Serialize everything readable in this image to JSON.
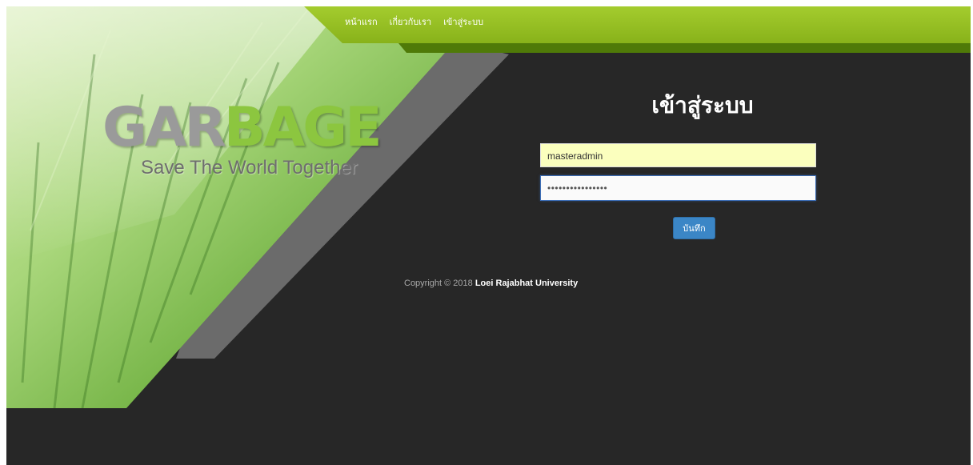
{
  "nav": {
    "items": [
      {
        "label": "หน้าแรก"
      },
      {
        "label": "เกี่ยวกับเรา"
      },
      {
        "label": "เข้าสู่ระบบ"
      }
    ]
  },
  "brand": {
    "logo_part1": "GAR",
    "logo_part2": "BAGE",
    "tagline": "Save The World Together"
  },
  "login": {
    "title": "เข้าสู่ระบบ",
    "username_value": "masteradmin",
    "password_masked": "••••••••••••••••",
    "submit_label": "บันทึก"
  },
  "footer": {
    "copyright_prefix": "Copyright © 2018 ",
    "organization": "Loei Rajabhat University"
  },
  "colors": {
    "accent_green": "#8cc63f",
    "nav_bar": "#93c01f",
    "background_dark": "#272727",
    "button_blue": "#3b86c6"
  }
}
